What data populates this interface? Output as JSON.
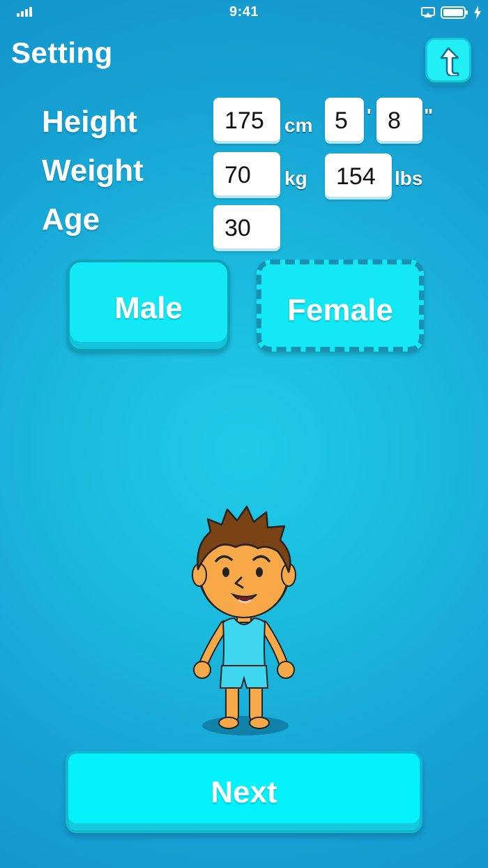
{
  "status_bar": {
    "time": "9:41"
  },
  "header": {
    "title": "Setting"
  },
  "form": {
    "height": {
      "label": "Height",
      "cm_value": "175",
      "cm_unit": "cm",
      "feet_value": "5",
      "feet_unit": "'",
      "inches_value": "8",
      "inches_unit": "\""
    },
    "weight": {
      "label": "Weight",
      "kg_value": "70",
      "kg_unit": "kg",
      "lbs_value": "154",
      "lbs_unit": "lbs"
    },
    "age": {
      "label": "Age",
      "value": "30"
    }
  },
  "gender": {
    "male_label": "Male",
    "female_label": "Female"
  },
  "footer": {
    "next_label": "Next"
  },
  "colors": {
    "accent": "#12e9f4",
    "background": "#1bb9dd"
  }
}
